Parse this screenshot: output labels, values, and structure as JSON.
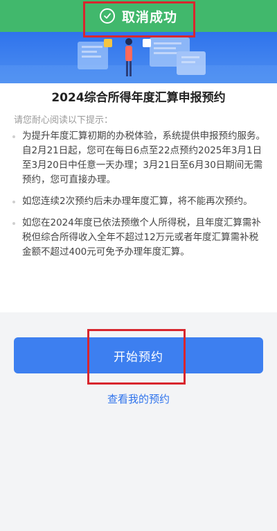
{
  "toast": {
    "text": "取消成功",
    "icon": "check-circle-icon"
  },
  "card": {
    "title": "2024综合所得年度汇算申报预约",
    "hint": "请您耐心阅读以下提示：",
    "items": [
      "为提升年度汇算初期的办税体验，系统提供申报预约服务。自2月21日起，您可在每日6点至22点预约2025年3月1日至3月20日中任意一天办理；3月21日至6月30日期间无需预约，您可直接办理。",
      "如您连续2次预约后未办理年度汇算，将不能再次预约。",
      "如您在2024年度已依法预缴个人所得税，且年度汇算需补税但综合所得收入全年不超过12万元或者年度汇算需补税金额不超过400元可免予办理年度汇算。"
    ]
  },
  "actions": {
    "start_label": "开始预约",
    "view_label": "查看我的预约"
  },
  "colors": {
    "toast_bg": "#41b86c",
    "primary": "#3d7ff0",
    "highlight": "#d8262e"
  }
}
